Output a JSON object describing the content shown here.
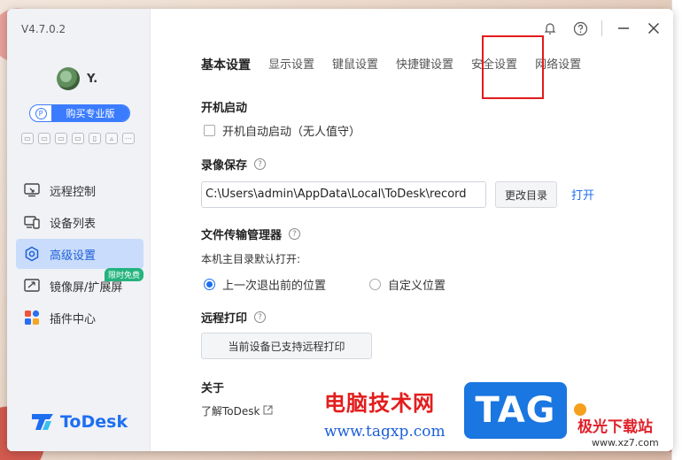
{
  "app": {
    "version": "V4.7.0.2",
    "user_name": "Y.",
    "pro_button": "购买专业版",
    "pro_icon_letter": "P",
    "logo_text": "ToDesk"
  },
  "sidebar": {
    "items": [
      {
        "label": "远程控制",
        "icon": "remote-control-icon"
      },
      {
        "label": "设备列表",
        "icon": "device-list-icon"
      },
      {
        "label": "高级设置",
        "icon": "advanced-settings-icon",
        "active": true
      },
      {
        "label": "镜像屏/扩展屏",
        "icon": "mirror-screen-icon",
        "badge": "限时免费"
      },
      {
        "label": "插件中心",
        "icon": "plugin-center-icon"
      }
    ]
  },
  "tabs": [
    "基本设置",
    "显示设置",
    "键鼠设置",
    "快捷键设置",
    "安全设置",
    "网络设置"
  ],
  "sections": {
    "startup": {
      "title": "开机启动",
      "checkbox_label": "开机自动启动（无人值守）"
    },
    "recording": {
      "title": "录像保存",
      "path": "C:\\Users\\admin\\AppData\\Local\\ToDesk\\record",
      "change_button": "更改目录",
      "open_link": "打开"
    },
    "file_transfer": {
      "title": "文件传输管理器",
      "default_label": "本机主目录默认打开:",
      "option_last": "上一次退出前的位置",
      "option_custom": "自定义位置"
    },
    "remote_print": {
      "title": "远程打印",
      "status_button": "当前设备已支持远程打印"
    },
    "about": {
      "title": "关于",
      "link": "了解ToDesk"
    }
  },
  "watermark": {
    "site_cn": "电脑技术网",
    "url": "www.tagxp.com",
    "tag": "TAG",
    "site2_cn": "极光下载站",
    "site2_url": "www.xz7.com"
  },
  "colors": {
    "accent": "#1e6ff0",
    "highlight": "#e21b1b",
    "badge": "#23b47e"
  }
}
